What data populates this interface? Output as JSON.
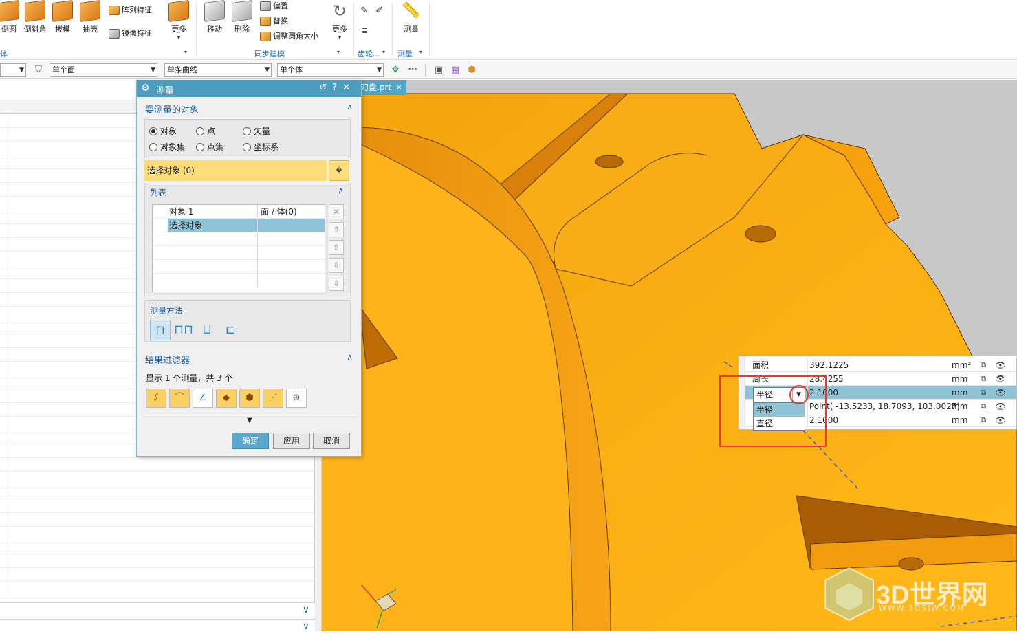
{
  "ribbon": {
    "buttons": [
      {
        "label": "倒圆"
      },
      {
        "label": "倒斜角"
      },
      {
        "label": "拔模"
      },
      {
        "label": "抽壳"
      },
      {
        "label": "更多"
      },
      {
        "label": "移动"
      },
      {
        "label": "删除"
      },
      {
        "label": "更多"
      },
      {
        "label": "测量"
      }
    ],
    "small_items": [
      "阵列特征",
      "镜像特征",
      "偏置",
      "替换",
      "调整圆角大小"
    ],
    "groups": [
      "体",
      "同步建模",
      "齿轮...",
      "测量"
    ]
  },
  "filter_bar": {
    "face_rule": "单个面",
    "curve_rule": "单条曲线",
    "body_rule": "单个体",
    "more": "⋯"
  },
  "document_tab": {
    "name": "刀盘.prt"
  },
  "dialog": {
    "title": "测量",
    "sections": {
      "objects": "要测量的对象",
      "list": "列表",
      "method": "测量方法",
      "filter": "结果过滤器"
    },
    "radios": [
      {
        "label": "对象",
        "checked": true
      },
      {
        "label": "点",
        "checked": false
      },
      {
        "label": "矢量",
        "checked": false
      },
      {
        "label": "对象集",
        "checked": false
      },
      {
        "label": "点集",
        "checked": false
      },
      {
        "label": "坐标系",
        "checked": false
      }
    ],
    "select_object": "选择对象 (0)",
    "list_rows": [
      {
        "name": "对象 1",
        "type": "面 / 体(0)"
      },
      {
        "name": "选择对象",
        "type": ""
      }
    ],
    "filter_summary": "显示 1 个测量，共 3 个",
    "buttons": {
      "ok": "确定",
      "apply": "应用",
      "cancel": "取消"
    }
  },
  "results": {
    "rows": [
      {
        "name": "面积",
        "value": "392.1225",
        "unit": "mm²"
      },
      {
        "name": "周长",
        "value": "28.4255",
        "unit": "mm"
      },
      {
        "name": "半径",
        "value": "2.1000",
        "unit": "mm"
      },
      {
        "name": "",
        "value": "Point( -13.5233, 18.7093, 103.0027)",
        "unit": "mm"
      },
      {
        "name": "",
        "value": "2.1000",
        "unit": "mm"
      }
    ],
    "combo_value": "半径",
    "options": [
      "半径",
      "直径"
    ]
  },
  "watermark": {
    "brand": "3D世界网",
    "url": "WWW.3DSJW.COM"
  },
  "colors": {
    "accent": "#4b9ebf",
    "selection": "#8fc3d8",
    "highlight": "#fddc7a",
    "part": "#f6a90f",
    "annotation": "#e8392f"
  }
}
